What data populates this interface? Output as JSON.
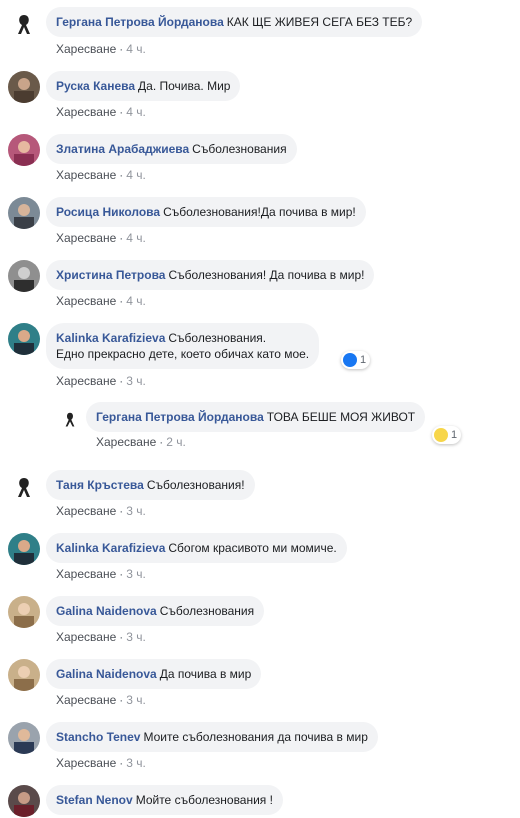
{
  "actions": {
    "like_label": "Харесване",
    "separator": "·"
  },
  "comments": [
    {
      "author": "Гергана Петрова Йорданова",
      "text": "КАК ЩЕ ЖИВЕЯ СЕГА БЕЗ ТЕБ?",
      "time": "4 ч."
    },
    {
      "author": "Руска Канева",
      "text": "Да. Почива. Мир",
      "time": "4 ч."
    },
    {
      "author": "Златина Арабаджиева",
      "text": "Съболезнования",
      "time": "4 ч."
    },
    {
      "author": "Росица Николова",
      "text": "Съболезнования!Да почива в мир!",
      "time": "4 ч."
    },
    {
      "author": "Христина Петрова",
      "text": "Съболезнования! Да почива в мир!",
      "time": "4 ч."
    },
    {
      "author": "Kalinka Karafizieva",
      "text": "Съболезнования.",
      "text_line2": "Едно прекрасно дете, което обичах като мое.",
      "time": "3 ч.",
      "reaction": {
        "type": "like",
        "count": "1"
      }
    },
    {
      "author": "Гергана Петрова Йорданова",
      "text": "ТОВА БЕШЕ МОЯ ЖИВОТ",
      "time": "2 ч.",
      "reaction": {
        "type": "sad",
        "count": "1"
      }
    },
    {
      "author": "Таня Кръстева",
      "text": "Съболезнования!",
      "time": "3 ч."
    },
    {
      "author": "Kalinka Karafizieva",
      "text": "Сбогом красивото ми момиче.",
      "time": "3 ч."
    },
    {
      "author": "Galina Naidenova",
      "text": "Съболезнования",
      "time": "3 ч."
    },
    {
      "author": "Galina Naidenova",
      "text": "Да почива в мир",
      "time": "3 ч."
    },
    {
      "author": "Stancho Tenev",
      "text": "Моите съболезнования да почива в мир",
      "time": "3 ч."
    },
    {
      "author": "Stefan Nenov",
      "text": "Мойте съболезнования !",
      "time": ""
    }
  ],
  "colors": {
    "name": "#385898",
    "bubble": "#f2f3f5",
    "meta": "#90949c"
  }
}
